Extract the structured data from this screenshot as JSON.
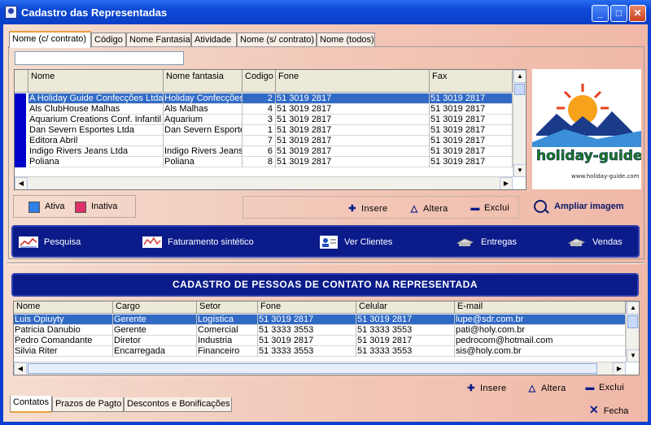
{
  "window": {
    "title": "Cadastro das Representadas",
    "controls": [
      "_",
      "□",
      "✕"
    ]
  },
  "top_tabs": [
    {
      "label": "Nome (c/ contrato)"
    },
    {
      "label": "Código"
    },
    {
      "label": "Nome Fantasia"
    },
    {
      "label": "Atividade"
    },
    {
      "label": "Nome (s/ contrato)"
    },
    {
      "label": "Nome (todos)"
    }
  ],
  "search": {
    "value": ""
  },
  "companies": {
    "headers": [
      "Nome",
      "Nome fantasia",
      "Codigo",
      "Fone",
      "Fax"
    ],
    "rows": [
      [
        "A Holiday Guide Confecções Ltda.",
        "Holiday Confecções",
        "2",
        "51 3019 2817",
        "51 3019 2817"
      ],
      [
        "Als ClubHouse Malhas",
        "Als Malhas",
        "4",
        "51 3019 2817",
        "51 3019 2817"
      ],
      [
        "Aquarium Creations Conf. Infantil Ltda",
        "Aquarium",
        "3",
        "51 3019 2817",
        "51 3019 2817"
      ],
      [
        "Dan Severn Esportes Ltda",
        "Dan Severn Esportes",
        "1",
        "51 3019 2817",
        "51 3019 2817"
      ],
      [
        "Editora Abril",
        "",
        "7",
        "51 3019 2817",
        "51 3019 2817"
      ],
      [
        "Indigo Rivers Jeans Ltda",
        "Indigo Rivers Jeans",
        "6",
        "51 3019 2817",
        "51 3019 2817"
      ],
      [
        "Poliana",
        "Poliana",
        "8",
        "51 3019 2817",
        "51 3019 2817"
      ]
    ],
    "selected_row": 0
  },
  "logo": {
    "text": "holiday-guide",
    "url_text": "www.holiday-guide.com"
  },
  "legend": {
    "ativa": {
      "label": "Ativa",
      "color": "#2e7fe8"
    },
    "inativa": {
      "label": "Inativa",
      "color": "#e0306a"
    }
  },
  "company_actions": {
    "insere": "Insere",
    "altera": "Altera",
    "exclui": "Exclui"
  },
  "ampliar_label": "Ampliar imagem",
  "action_bar": {
    "pesquisa": "Pesquisa",
    "faturamento": "Faturamento sintético",
    "ver_clientes": "Ver Clientes",
    "entregas": "Entregas",
    "vendas": "Vendas"
  },
  "contacts_title": "CADASTRO DE PESSOAS DE CONTATO NA REPRESENTADA",
  "contacts": {
    "headers": [
      "Nome",
      "Cargo",
      "Setor",
      "Fone",
      "Celular",
      "E-mail"
    ],
    "rows": [
      [
        "Luis Opiuyty",
        "Gerente",
        "Logística",
        "51 3019 2817",
        "51 3019 2817",
        "lupe@sdr.com.br"
      ],
      [
        "Patricia Danubio",
        "Gerente",
        "Comercial",
        "51 3333 3553",
        "51 3333 3553",
        "pati@holy.com.br"
      ],
      [
        "Pedro Comandante",
        "Diretor",
        "Industria",
        "51 3019 2817",
        "51 3019 2817",
        "pedrocom@hotmail.com"
      ],
      [
        "Silvia Riter",
        "Encarregada",
        "Financeiro",
        "51 3333 3553",
        "51 3333 3553",
        "sis@holy.com.br"
      ]
    ],
    "selected_row": 0
  },
  "contact_actions": {
    "insere": "Insere",
    "altera": "Altera",
    "exclui": "Exclui"
  },
  "bottom_tabs": [
    {
      "label": "Contatos"
    },
    {
      "label": "Prazos de Pagto"
    },
    {
      "label": "Descontos e Bonificações"
    }
  ],
  "fecha_label": "Fecha"
}
